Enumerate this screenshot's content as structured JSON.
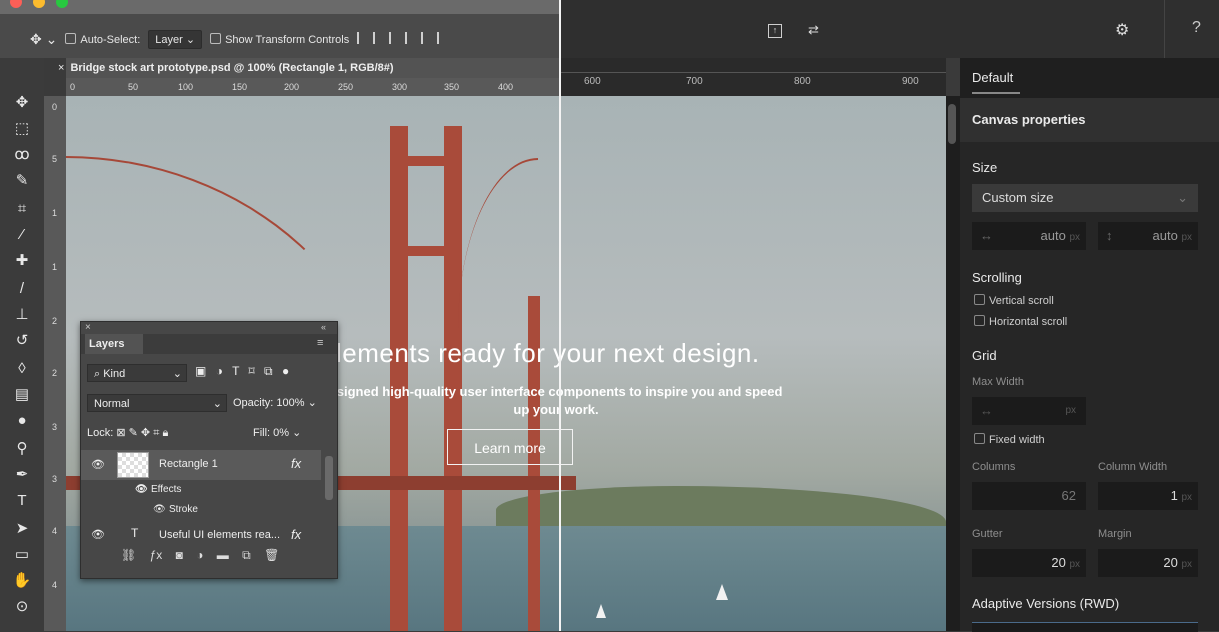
{
  "ps": {
    "options": {
      "auto_select_label": "Auto-Select:",
      "auto_select_value": "Layer",
      "show_transform_label": "Show Transform Controls"
    },
    "doc_tab": "Bridge stock art prototype.psd @ 100% (Rectangle 1, RGB/8#)",
    "ruler_marks": [
      "0",
      "50",
      "100",
      "150",
      "200",
      "250",
      "300",
      "350",
      "400"
    ],
    "vruler_marks": [
      "0",
      "5",
      "1",
      "1",
      "2",
      "2",
      "3",
      "3",
      "4",
      "4"
    ]
  },
  "app": {
    "ruler_marks": [
      "600",
      "700",
      "800",
      "900"
    ]
  },
  "canvas": {
    "headline": "lements ready for your next design.",
    "subtitle": "esigned high-quality user interface components to inspire you and speed up your work.",
    "button": "Learn more"
  },
  "layers": {
    "tab": "Layers",
    "kind": "Kind",
    "blend": "Normal",
    "opacity_label": "Opacity:",
    "opacity_value": "100%",
    "lock_label": "Lock:",
    "fill_label": "Fill:",
    "fill_value": "0%",
    "items": [
      {
        "name": "Rectangle 1",
        "fx": "fx"
      },
      {
        "name": "Effects"
      },
      {
        "name": "Stroke"
      },
      {
        "name": "Useful UI elements rea...",
        "fx": "fx"
      }
    ]
  },
  "right_panel": {
    "preset": "Default",
    "section_title": "Canvas properties",
    "size_label": "Size",
    "size_value": "Custom size",
    "width_value": "auto",
    "height_value": "auto",
    "unit": "px",
    "scrolling_label": "Scrolling",
    "vertical_scroll": "Vertical scroll",
    "horizontal_scroll": "Horizontal scroll",
    "grid_label": "Grid",
    "max_width_label": "Max Width",
    "fixed_width": "Fixed width",
    "columns_label": "Columns",
    "columns_value": "62",
    "column_width_label": "Column Width",
    "column_width_value": "1",
    "gutter_label": "Gutter",
    "gutter_value": "20",
    "margin_label": "Margin",
    "margin_value": "20",
    "adaptive_label": "Adaptive Versions (RWD)"
  }
}
